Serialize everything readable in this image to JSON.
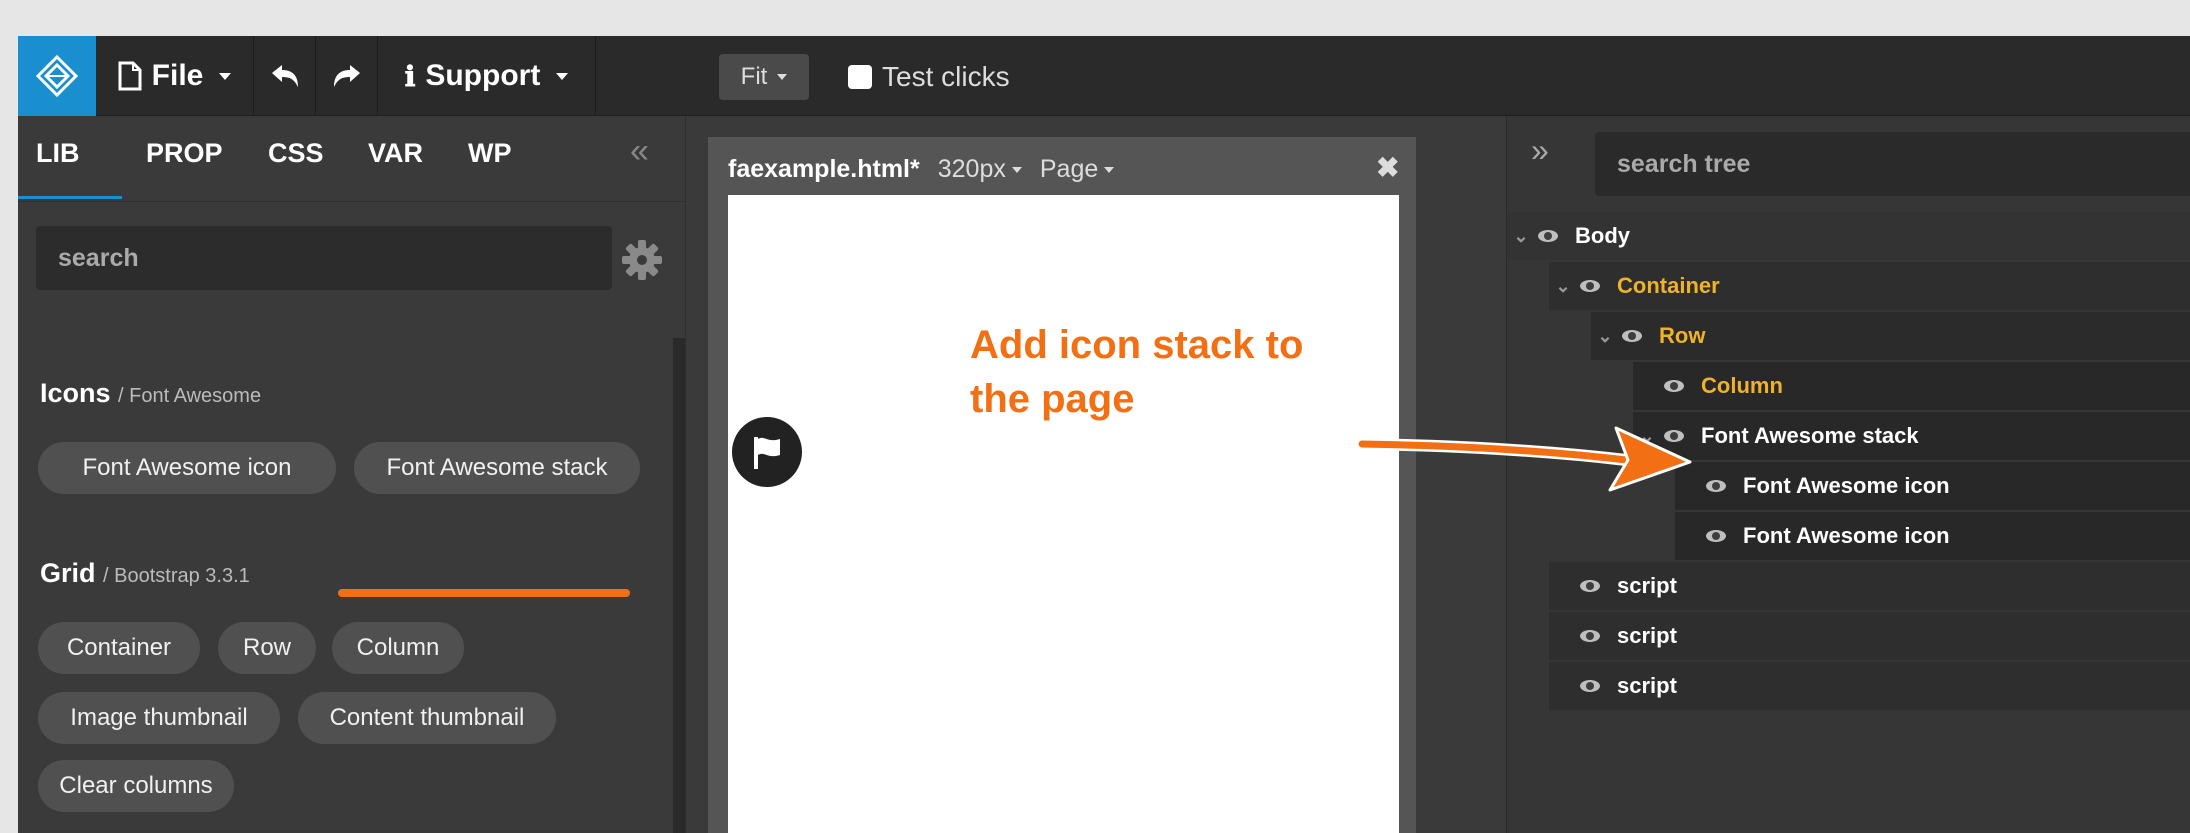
{
  "topbar": {
    "file_label": "File",
    "support_label": "Support",
    "fit_label": "Fit",
    "test_clicks_label": "Test clicks",
    "brand_color": "#1a8fd0"
  },
  "left_panel": {
    "tabs": [
      {
        "label": "LIB",
        "active": true
      },
      {
        "label": "PROP",
        "active": false
      },
      {
        "label": "CSS",
        "active": false
      },
      {
        "label": "VAR",
        "active": false
      },
      {
        "label": "WP",
        "active": false
      }
    ],
    "collapse_glyph": "«",
    "search_placeholder": "search",
    "sections": [
      {
        "title": "Icons",
        "subtitle": "/ Font Awesome",
        "items": [
          "Font Awesome icon",
          "Font Awesome stack"
        ]
      },
      {
        "title": "Grid",
        "subtitle": "/ Bootstrap 3.3.1",
        "items": [
          "Container",
          "Row",
          "Column",
          "Image thumbnail",
          "Content thumbnail",
          "Clear columns"
        ]
      }
    ]
  },
  "document": {
    "filename": "faexample.html",
    "modified_marker": "*",
    "width_label": "320px",
    "page_label": "Page",
    "close_glyph": "✖"
  },
  "annotation": {
    "line1": "Add icon stack to",
    "line2": "the page",
    "color": "#f36f13"
  },
  "tree_panel": {
    "expand_glyph": "»",
    "search_placeholder": "search tree",
    "nodes": [
      {
        "label": "Body",
        "expanded": true,
        "highlight": false
      },
      {
        "label": "Container",
        "expanded": true,
        "highlight": true
      },
      {
        "label": "Row",
        "expanded": true,
        "highlight": true
      },
      {
        "label": "Column",
        "expanded": false,
        "highlight": true
      },
      {
        "label": "Font Awesome stack",
        "expanded": true,
        "highlight": false
      },
      {
        "label": "Font Awesome icon",
        "expanded": false,
        "highlight": false
      },
      {
        "label": "Font Awesome icon",
        "expanded": false,
        "highlight": false
      },
      {
        "label": "script",
        "expanded": false,
        "highlight": false
      },
      {
        "label": "script",
        "expanded": false,
        "highlight": false
      },
      {
        "label": "script",
        "expanded": false,
        "highlight": false
      }
    ],
    "highlight_color": "#f0b22b"
  }
}
